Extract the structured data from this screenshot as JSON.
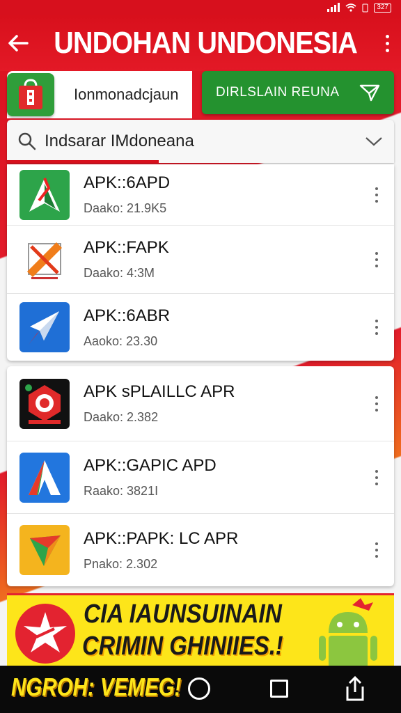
{
  "status_bar": {
    "battery": "327"
  },
  "app_bar": {
    "title": "UNDOHAN UNDONESIA"
  },
  "tabs": {
    "left_label": "Ionmonadcjaun",
    "right_label": "DIRLSLAIN REUNA"
  },
  "search": {
    "value": "Indsarar IMdoneana"
  },
  "apps": [
    {
      "name": "APK::6APD",
      "meta": "Daako: 21.9K5",
      "icon": "green-arrow-a-icon",
      "color": "#2da44a"
    },
    {
      "name": "APK::FAPK",
      "meta": "Daako: 4:3M",
      "icon": "orange-pencil-icon",
      "color": "#f07d1a"
    },
    {
      "name": "APK::6ABR",
      "meta": "Aaoko: 23.30",
      "icon": "blue-rocket-icon",
      "color": "#1f6fd6"
    },
    {
      "name": "APK sPLAILLC APR",
      "meta": "Daako: 2.382",
      "icon": "red-shield-icon",
      "color": "#e02a2a"
    },
    {
      "name": "APK::GAPIC APD",
      "meta": "Raako: 3821I",
      "icon": "blue-a-icon",
      "color": "#2276de"
    },
    {
      "name": "APK::PAPK: LC APR",
      "meta": "Pnako: 2.302",
      "icon": "yellow-play-icon",
      "color": "#f4b41e"
    }
  ],
  "banner": {
    "line1": "CIA IAUNSUINAIN",
    "line2": "CRIMIN GHINIIES.!"
  },
  "navbar": {
    "promo": "NGROH: VEMEG!"
  }
}
